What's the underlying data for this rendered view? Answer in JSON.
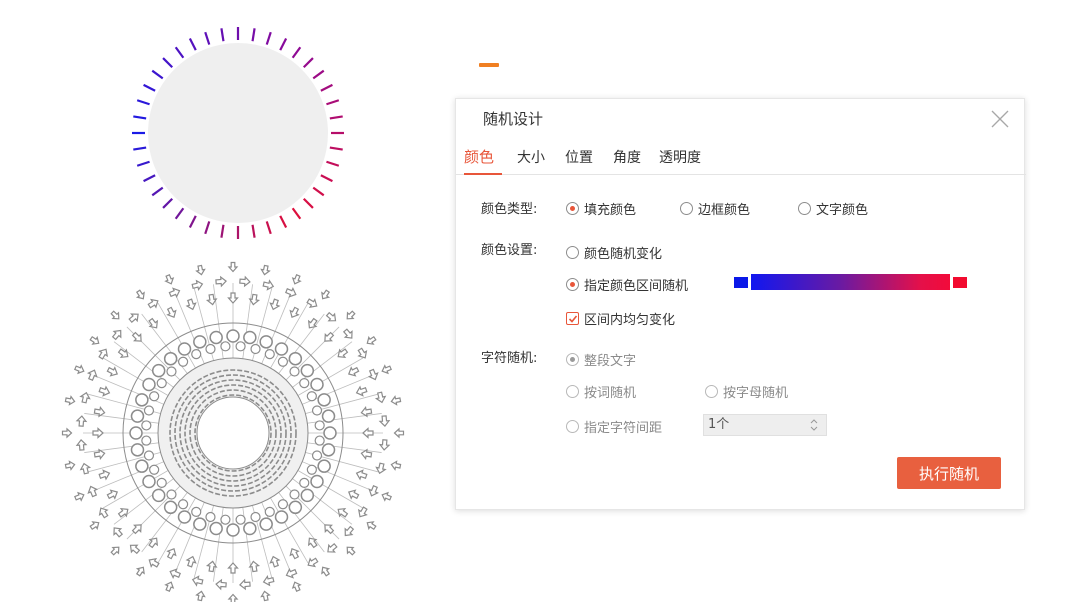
{
  "dialog": {
    "title": "随机设计",
    "close_icon": "close-icon",
    "tabs": [
      {
        "label": "颜色",
        "active": true
      },
      {
        "label": "大小",
        "active": false
      },
      {
        "label": "位置",
        "active": false
      },
      {
        "label": "角度",
        "active": false
      },
      {
        "label": "透明度",
        "active": false
      }
    ],
    "color_type": {
      "label": "颜色类型:",
      "options": [
        {
          "label": "填充颜色",
          "checked": true
        },
        {
          "label": "边框颜色",
          "checked": false
        },
        {
          "label": "文字颜色",
          "checked": false
        }
      ]
    },
    "color_setting": {
      "label": "颜色设置:",
      "options": [
        {
          "label": "颜色随机变化",
          "checked": false
        },
        {
          "label": "指定颜色区间随机",
          "checked": true
        }
      ],
      "range_start_color": "#0a18e8",
      "range_end_color": "#f20b2f",
      "uniform_checkbox": {
        "label": "区间内均匀变化",
        "checked": true
      }
    },
    "char_random": {
      "label": "字符随机:",
      "options": [
        {
          "label": "整段文字",
          "checked": true
        },
        {
          "label": "按词随机",
          "checked": false
        },
        {
          "label": "按字母随机",
          "checked": false
        },
        {
          "label": "指定字符间距",
          "checked": false
        }
      ],
      "spacing_value": "1个"
    },
    "execute_button": "执行随机"
  },
  "colors": {
    "accent": "#e8563a",
    "button": "#e8603f",
    "dash": "#f07f22",
    "gauge_blue": "#1a1ae6",
    "gauge_purple": "#8a0a9a",
    "gauge_red": "#e0103a"
  }
}
